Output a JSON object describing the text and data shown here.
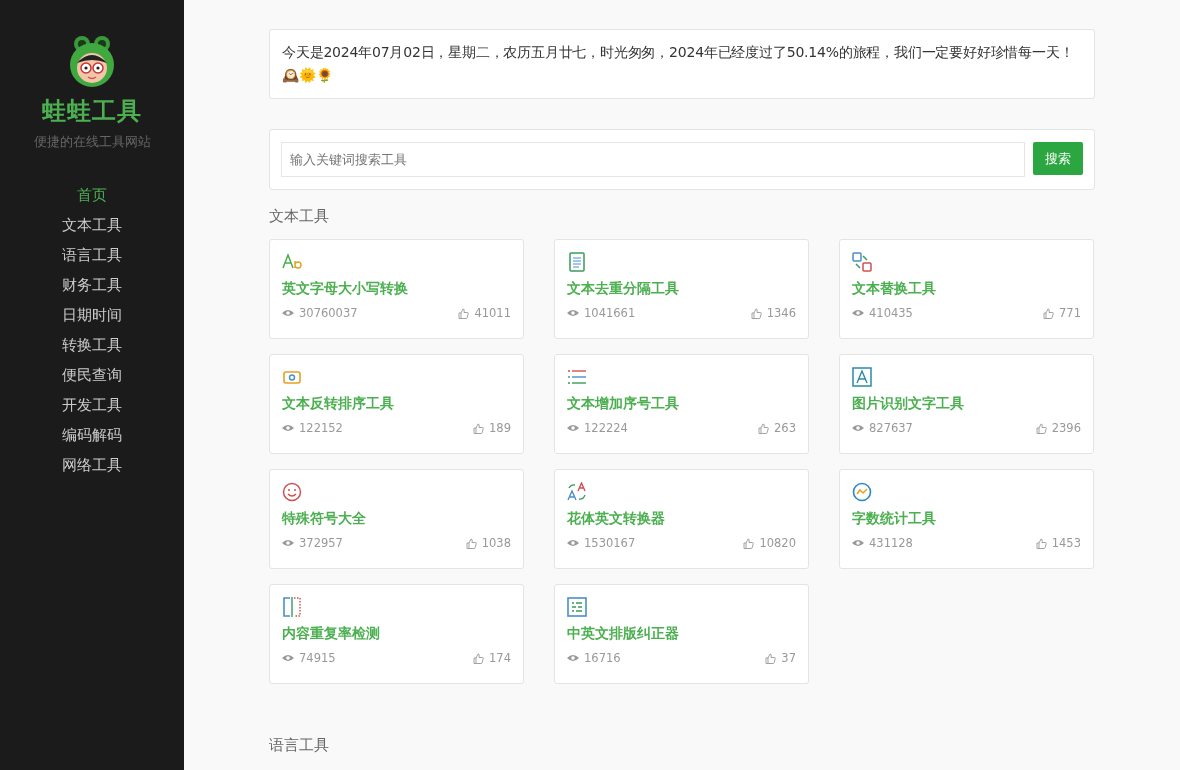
{
  "sidebar": {
    "logo_title": "蛙蛙工具",
    "subtitle": "便捷的在线工具网站",
    "items": [
      {
        "label": "首页",
        "selected": true
      },
      {
        "label": "文本工具",
        "selected": false
      },
      {
        "label": "语言工具",
        "selected": false
      },
      {
        "label": "财务工具",
        "selected": false
      },
      {
        "label": "日期时间",
        "selected": false
      },
      {
        "label": "转换工具",
        "selected": false
      },
      {
        "label": "便民查询",
        "selected": false
      },
      {
        "label": "开发工具",
        "selected": false
      },
      {
        "label": "编码解码",
        "selected": false
      },
      {
        "label": "网络工具",
        "selected": false
      }
    ]
  },
  "notice": "今天是2024年07月02日，星期二，农历五月廿七，时光匆匆，2024年已经度过了50.14%的旅程，我们一定要好好珍惜每一天！🕰️🌞🌻",
  "search": {
    "placeholder": "输入关键词搜索工具",
    "button": "搜索"
  },
  "sections": [
    {
      "title": "文本工具",
      "tools": [
        {
          "name": "英文字母大小写转换",
          "views": "30760037",
          "likes": "41011"
        },
        {
          "name": "文本去重分隔工具",
          "views": "1041661",
          "likes": "1346"
        },
        {
          "name": "文本替换工具",
          "views": "410435",
          "likes": "771"
        },
        {
          "name": "文本反转排序工具",
          "views": "122152",
          "likes": "189"
        },
        {
          "name": "文本增加序号工具",
          "views": "122224",
          "likes": "263"
        },
        {
          "name": "图片识别文字工具",
          "views": "827637",
          "likes": "2396"
        },
        {
          "name": "特殊符号大全",
          "views": "372957",
          "likes": "1038"
        },
        {
          "name": "花体英文转换器",
          "views": "1530167",
          "likes": "10820"
        },
        {
          "name": "字数统计工具",
          "views": "431128",
          "likes": "1453"
        },
        {
          "name": "内容重复率检测",
          "views": "74915",
          "likes": "174"
        },
        {
          "name": "中英文排版纠正器",
          "views": "16716",
          "likes": "37"
        }
      ]
    },
    {
      "title": "语言工具"
    }
  ]
}
